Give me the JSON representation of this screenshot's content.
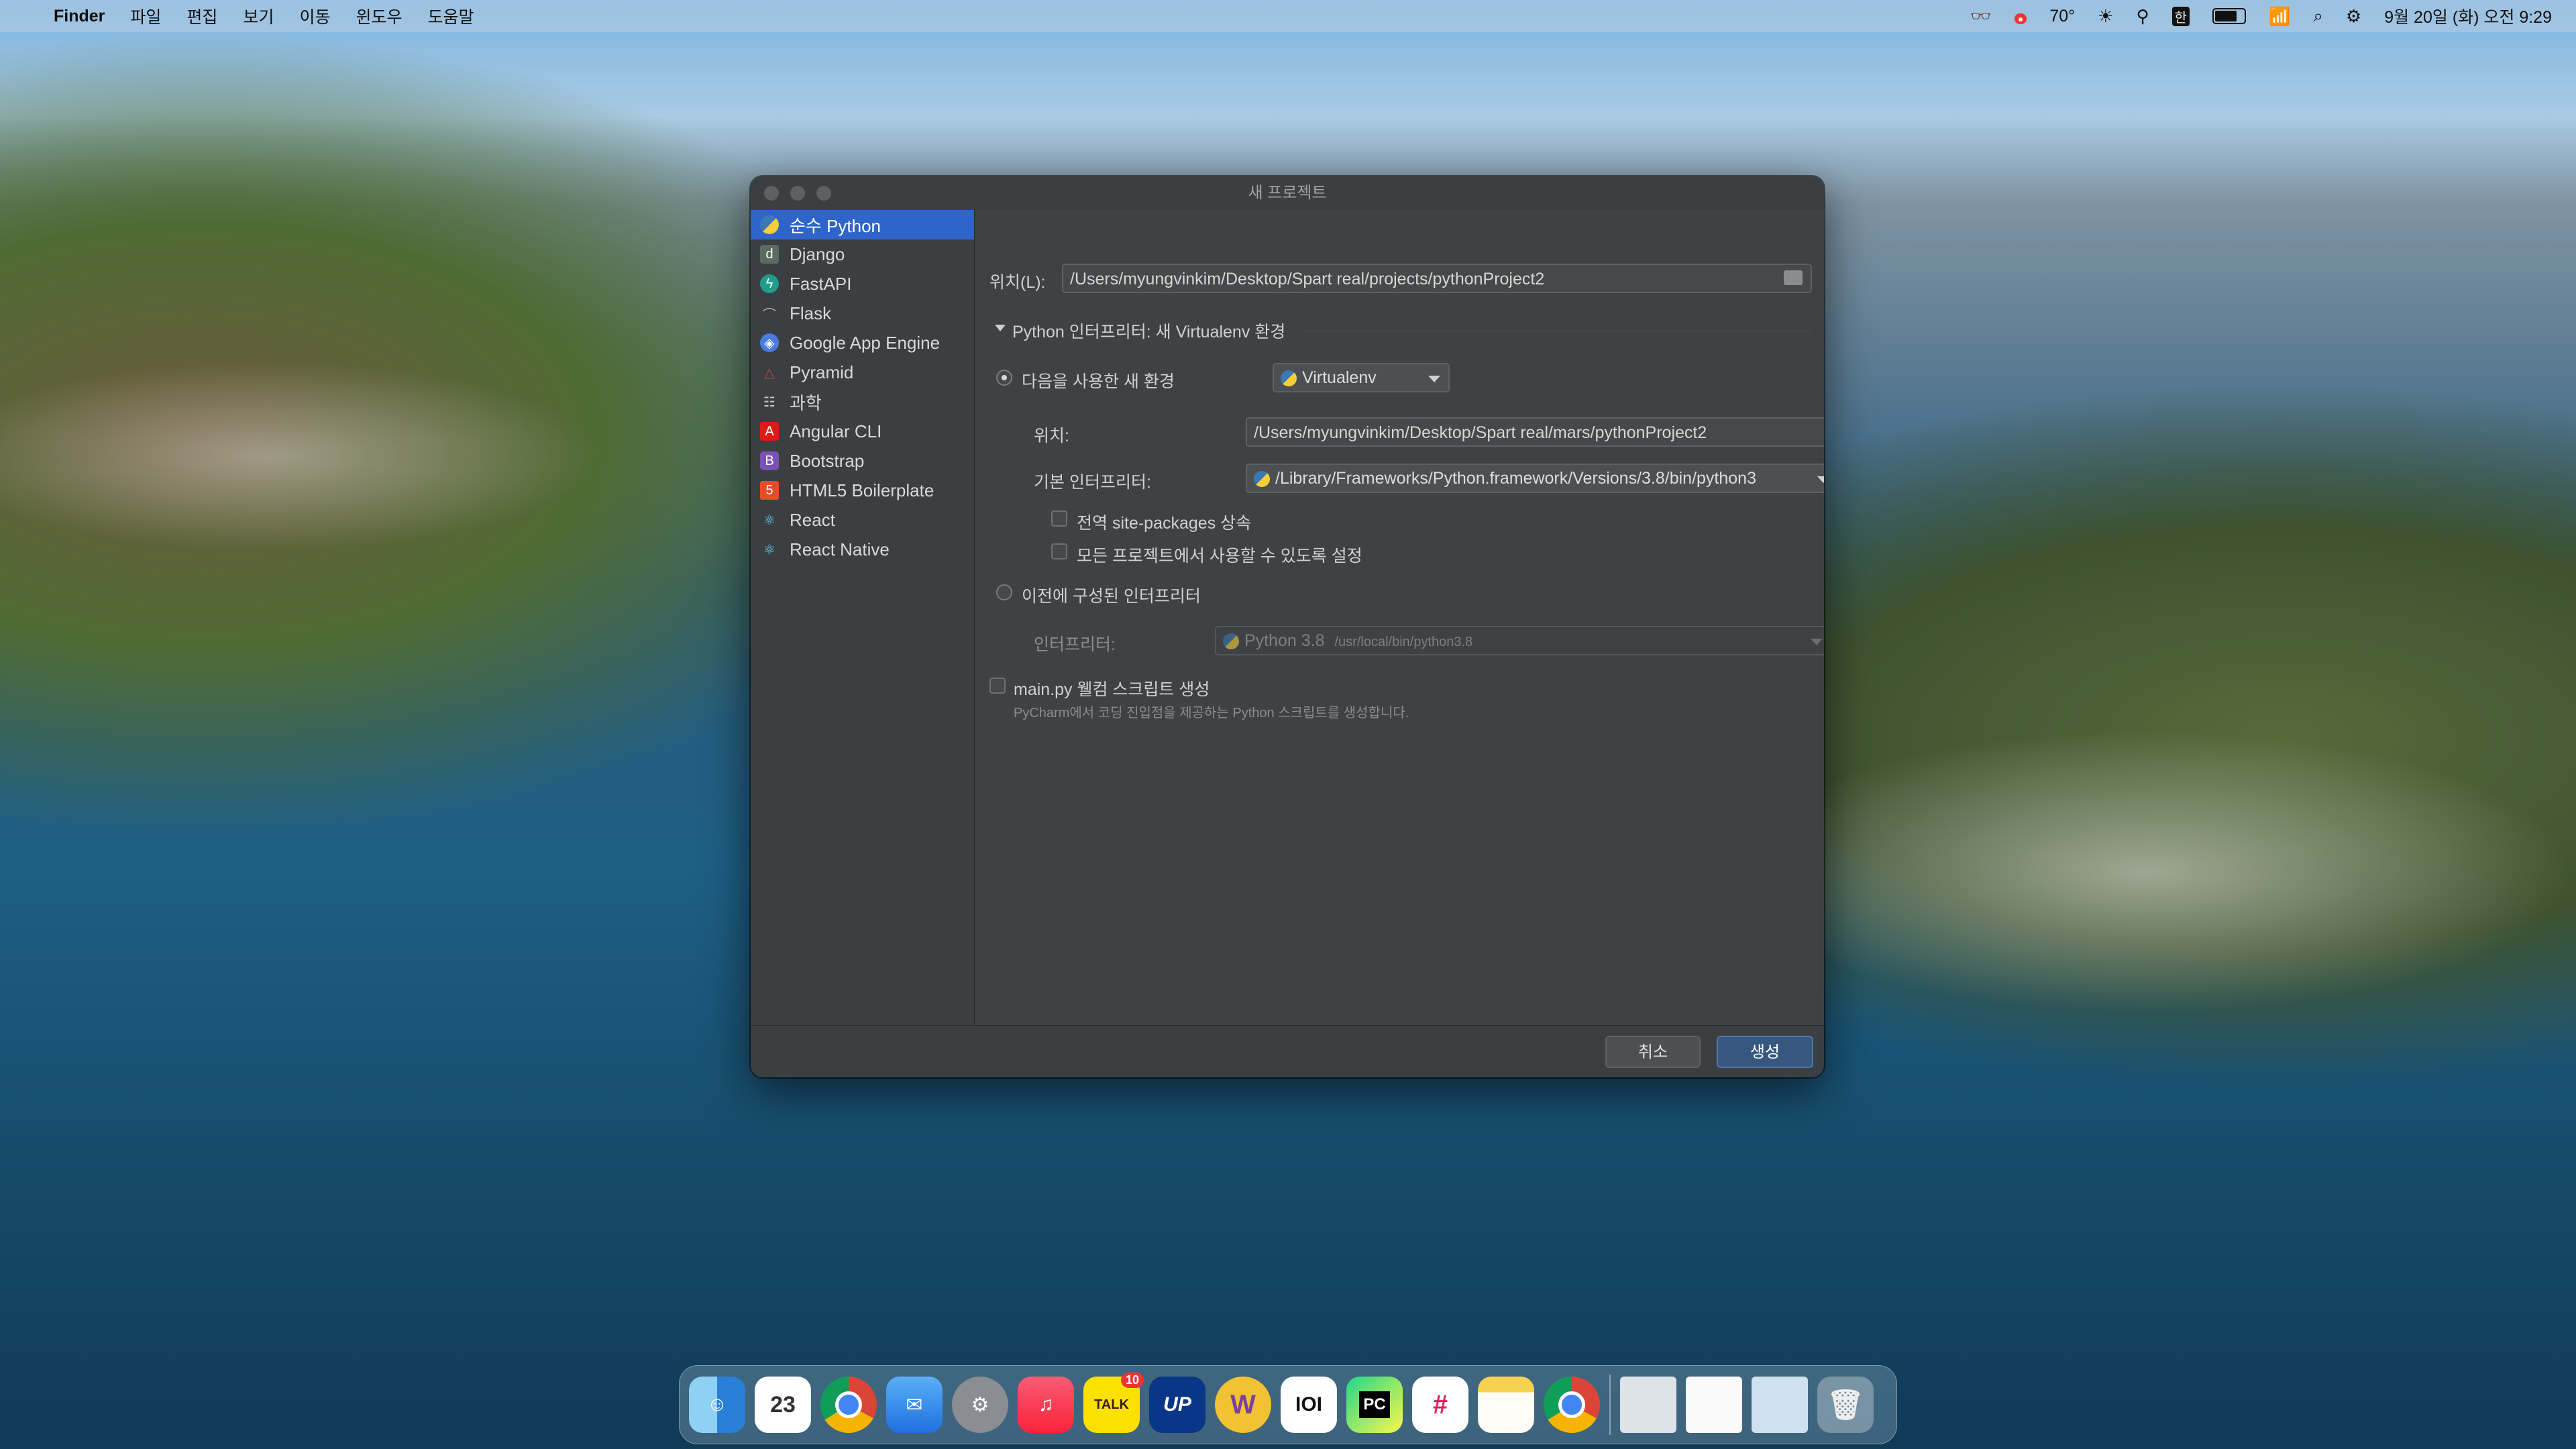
{
  "menubar": {
    "app_name": "Finder",
    "menus": [
      "파일",
      "편집",
      "보기",
      "이동",
      "윈도우",
      "도움말"
    ],
    "weather": "70°",
    "datetime": "9월 20일 (화) 오전 9:29",
    "input_method": "한"
  },
  "window": {
    "title": "새 프로젝트"
  },
  "sidebar": {
    "items": [
      {
        "label": "순수 Python",
        "icon": "python-icon",
        "color": "#3b78b4"
      },
      {
        "label": "Django",
        "icon": "django-icon",
        "color": "#5b6b63"
      },
      {
        "label": "FastAPI",
        "icon": "fastapi-icon",
        "color": "#1f9c8a"
      },
      {
        "label": "Flask",
        "icon": "flask-icon",
        "color": "#777777"
      },
      {
        "label": "Google App Engine",
        "icon": "google-app-engine-icon",
        "color": "#4a7be0"
      },
      {
        "label": "Pyramid",
        "icon": "pyramid-icon",
        "color": "#c04545"
      },
      {
        "label": "과학",
        "icon": "science-icon",
        "color": "#888888"
      },
      {
        "label": "Angular CLI",
        "icon": "angular-icon",
        "color": "#dd1b16"
      },
      {
        "label": "Bootstrap",
        "icon": "bootstrap-icon",
        "color": "#7952b3"
      },
      {
        "label": "HTML5 Boilerplate",
        "icon": "html5-icon",
        "color": "#e44d26"
      },
      {
        "label": "React",
        "icon": "react-icon",
        "color": "#61dafb"
      },
      {
        "label": "React Native",
        "icon": "react-native-icon",
        "color": "#61dafb"
      }
    ]
  },
  "form": {
    "location_label": "위치(L):",
    "location_value": "/Users/myungvinkim/Desktop/Spart real/projects/pythonProject2",
    "interpreter_section": "Python 인터프리터: 새 Virtualenv 환경",
    "new_env_label": "다음을 사용한 새 환경",
    "env_type": "Virtualenv",
    "env_location_label": "위치:",
    "env_location_value": "/Users/myungvinkim/Desktop/Spart real/mars/pythonProject2",
    "base_interp_label": "기본 인터프리터:",
    "base_interp_value": "/Library/Frameworks/Python.framework/Versions/3.8/bin/python3",
    "dots_label": "...",
    "inherit_label": "전역 site-packages 상속",
    "all_projects_label": "모든 프로젝트에서 사용할 수 있도록 설정",
    "prev_interp_label": "이전에 구성된 인터프리터",
    "interp_label": "인터프리터:",
    "interp_value": "Python 3.8",
    "interp_path": "/usr/local/bin/python3.8",
    "welcome_label": "main.py 웰컴 스크립트 생성",
    "welcome_desc": "PyCharm에서 코딩 진입점을 제공하는 Python 스크립트를 생성합니다."
  },
  "buttons": {
    "cancel": "취소",
    "create": "생성"
  },
  "dock": {
    "calendar_day": "23",
    "talk_label": "TALK",
    "talk_badge": "10",
    "up_label": "UP",
    "pc_label": "PC"
  }
}
